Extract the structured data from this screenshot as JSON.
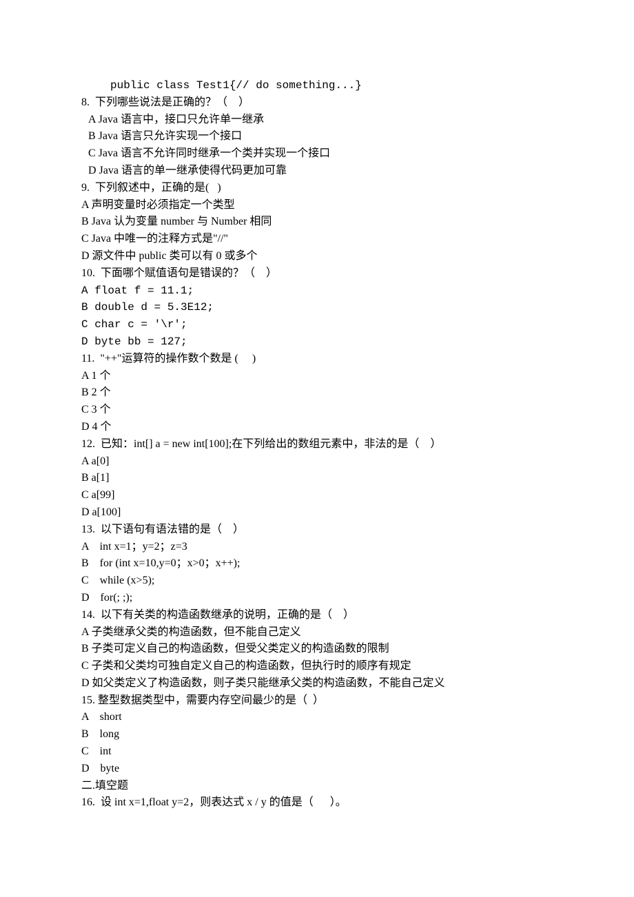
{
  "lines": [
    {
      "cls": "indent mono",
      "text": "public class Test1{// do something...}"
    },
    {
      "cls": "",
      "text": "8.  下列哪些说法是正确的？（    ）"
    },
    {
      "cls": "indent-sm",
      "text": "A Java 语言中，接口只允许单一继承"
    },
    {
      "cls": "indent-sm",
      "text": "B Java 语言只允许实现一个接口"
    },
    {
      "cls": "indent-sm",
      "text": "C Java 语言不允许同时继承一个类并实现一个接口"
    },
    {
      "cls": "indent-sm",
      "text": "D Java 语言的单一继承使得代码更加可靠"
    },
    {
      "cls": "",
      "text": "9.  下列叙述中，正确的是(   )"
    },
    {
      "cls": "",
      "text": "A 声明变量时必须指定一个类型"
    },
    {
      "cls": "",
      "text": "B Java 认为变量 number 与 Number 相同"
    },
    {
      "cls": "",
      "text": "C Java 中唯一的注释方式是\"//\""
    },
    {
      "cls": "",
      "text": "D 源文件中 public 类可以有 0 或多个"
    },
    {
      "cls": "",
      "text": "10.  下面哪个赋值语句是错误的？（    ）"
    },
    {
      "cls": "mono",
      "text": "A float f = 11.1;"
    },
    {
      "cls": "mono",
      "text": "B double d = 5.3E12;"
    },
    {
      "cls": "mono",
      "text": "C char c = '\\r';"
    },
    {
      "cls": "mono",
      "text": "D byte bb = 127;"
    },
    {
      "cls": "",
      "text": "11.  \"++\"运算符的操作数个数是 (     )"
    },
    {
      "cls": "",
      "text": "A 1 个"
    },
    {
      "cls": "",
      "text": "B 2 个"
    },
    {
      "cls": "",
      "text": "C 3 个"
    },
    {
      "cls": "",
      "text": "D 4 个"
    },
    {
      "cls": "",
      "text": "12.  已知：int[] a = new int[100];在下列给出的数组元素中，非法的是（    ）"
    },
    {
      "cls": "",
      "text": "A a[0]"
    },
    {
      "cls": "",
      "text": "B a[1]"
    },
    {
      "cls": "",
      "text": "C a[99]"
    },
    {
      "cls": "",
      "text": "D a[100]"
    },
    {
      "cls": "",
      "text": "13.  以下语句有语法错的是（    ）"
    },
    {
      "cls": "",
      "text": "A    int x=1；y=2；z=3"
    },
    {
      "cls": "",
      "text": "B    for (int x=10,y=0；x>0；x++);"
    },
    {
      "cls": "",
      "text": "C    while (x>5);"
    },
    {
      "cls": "",
      "text": "D    for(; ;);"
    },
    {
      "cls": "",
      "text": "14.  以下有关类的构造函数继承的说明，正确的是（    ）"
    },
    {
      "cls": "",
      "text": "A 子类继承父类的构造函数，但不能自己定义"
    },
    {
      "cls": "",
      "text": "B 子类可定义自己的构造函数，但受父类定义的构造函数的限制"
    },
    {
      "cls": "",
      "text": "C 子类和父类均可独自定义自己的构造函数，但执行时的顺序有规定"
    },
    {
      "cls": "",
      "text": "D 如父类定义了构造函数，则子类只能继承父类的构造函数，不能自己定义"
    },
    {
      "cls": "",
      "text": "15. 整型数据类型中，需要内存空间最少的是（  ）"
    },
    {
      "cls": "",
      "text": "A    short"
    },
    {
      "cls": "",
      "text": "B    long"
    },
    {
      "cls": "",
      "text": "C    int"
    },
    {
      "cls": "",
      "text": "D    byte"
    },
    {
      "cls": "",
      "text": "二.填空题"
    },
    {
      "cls": "",
      "text": "16.  设 int x=1,float y=2，则表达式 x / y 的值是（      ）。"
    }
  ]
}
